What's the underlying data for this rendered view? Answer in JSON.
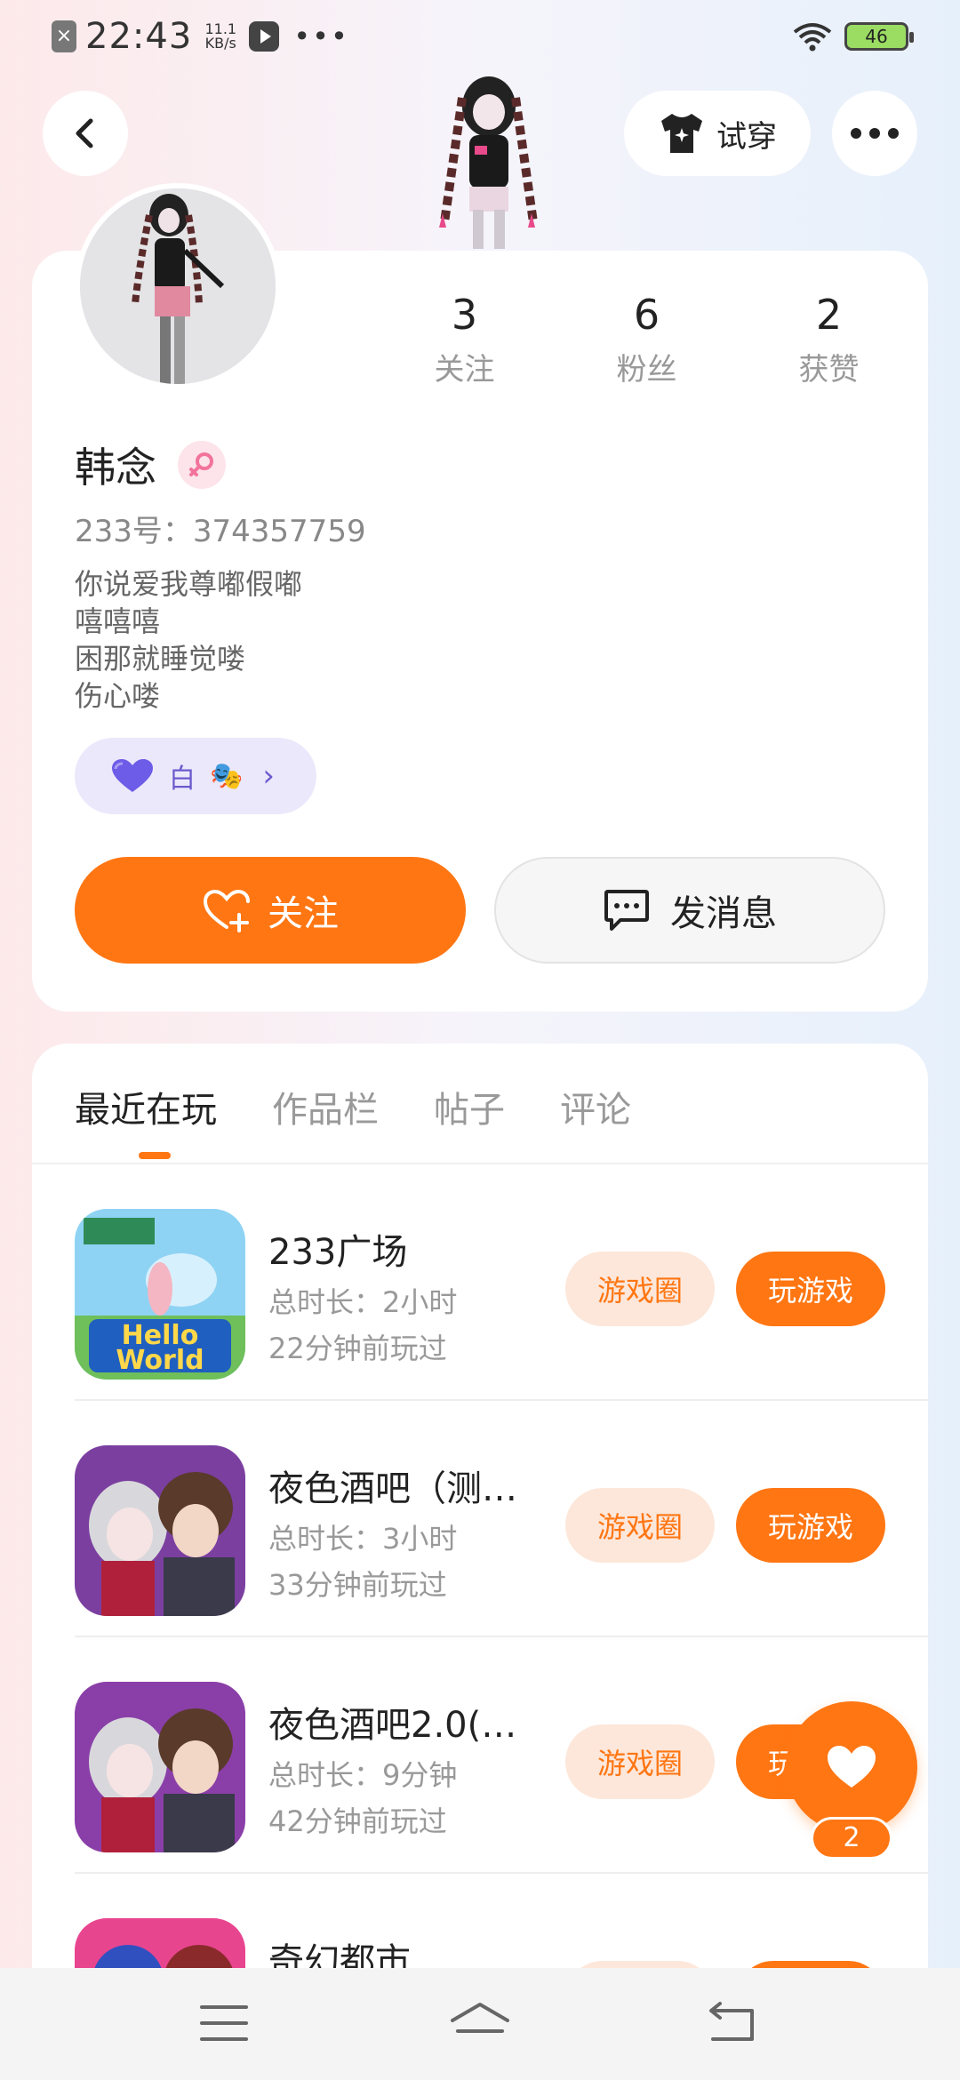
{
  "status_bar": {
    "time": "22:43",
    "net_speed_value": "11.1",
    "net_speed_unit": "KB/s",
    "battery": "46"
  },
  "top_nav": {
    "try_on_label": "试穿"
  },
  "profile": {
    "username": "韩念",
    "uid_label": "233号：374357759",
    "bio": [
      "你说爱我尊嘟假嘟",
      "嘻嘻嘻",
      "困那就睡觉喽",
      "伤心喽"
    ],
    "stats": [
      {
        "value": "3",
        "label": "关注"
      },
      {
        "value": "6",
        "label": "粉丝"
      },
      {
        "value": "2",
        "label": "获赞"
      }
    ],
    "badge_label": "白",
    "follow_label": "关注",
    "message_label": "发消息"
  },
  "tabs": [
    {
      "label": "最近在玩",
      "active": true
    },
    {
      "label": "作品栏",
      "active": false
    },
    {
      "label": "帖子",
      "active": false
    },
    {
      "label": "评论",
      "active": false
    }
  ],
  "games": [
    {
      "name": "233广场",
      "duration": "总时长：2小时",
      "last_played": "22分钟前玩过",
      "circle_label": "游戏圈",
      "play_label": "玩游戏"
    },
    {
      "name": "夜色酒吧（测…",
      "duration": "总时长：3小时",
      "last_played": "33分钟前玩过",
      "circle_label": "游戏圈",
      "play_label": "玩游戏"
    },
    {
      "name": "夜色酒吧2.0(…",
      "duration": "总时长：9分钟",
      "last_played": "42分钟前玩过",
      "circle_label": "游戏圈",
      "play_label": "玩游戏"
    },
    {
      "name": "奇幻都市",
      "duration": "",
      "last_played": "",
      "circle_label": "",
      "play_label": ""
    }
  ],
  "float_like_count": "2",
  "colors": {
    "accent": "#ff7613",
    "accent_light": "#fde7da",
    "badge_bg": "#ece8fb"
  }
}
